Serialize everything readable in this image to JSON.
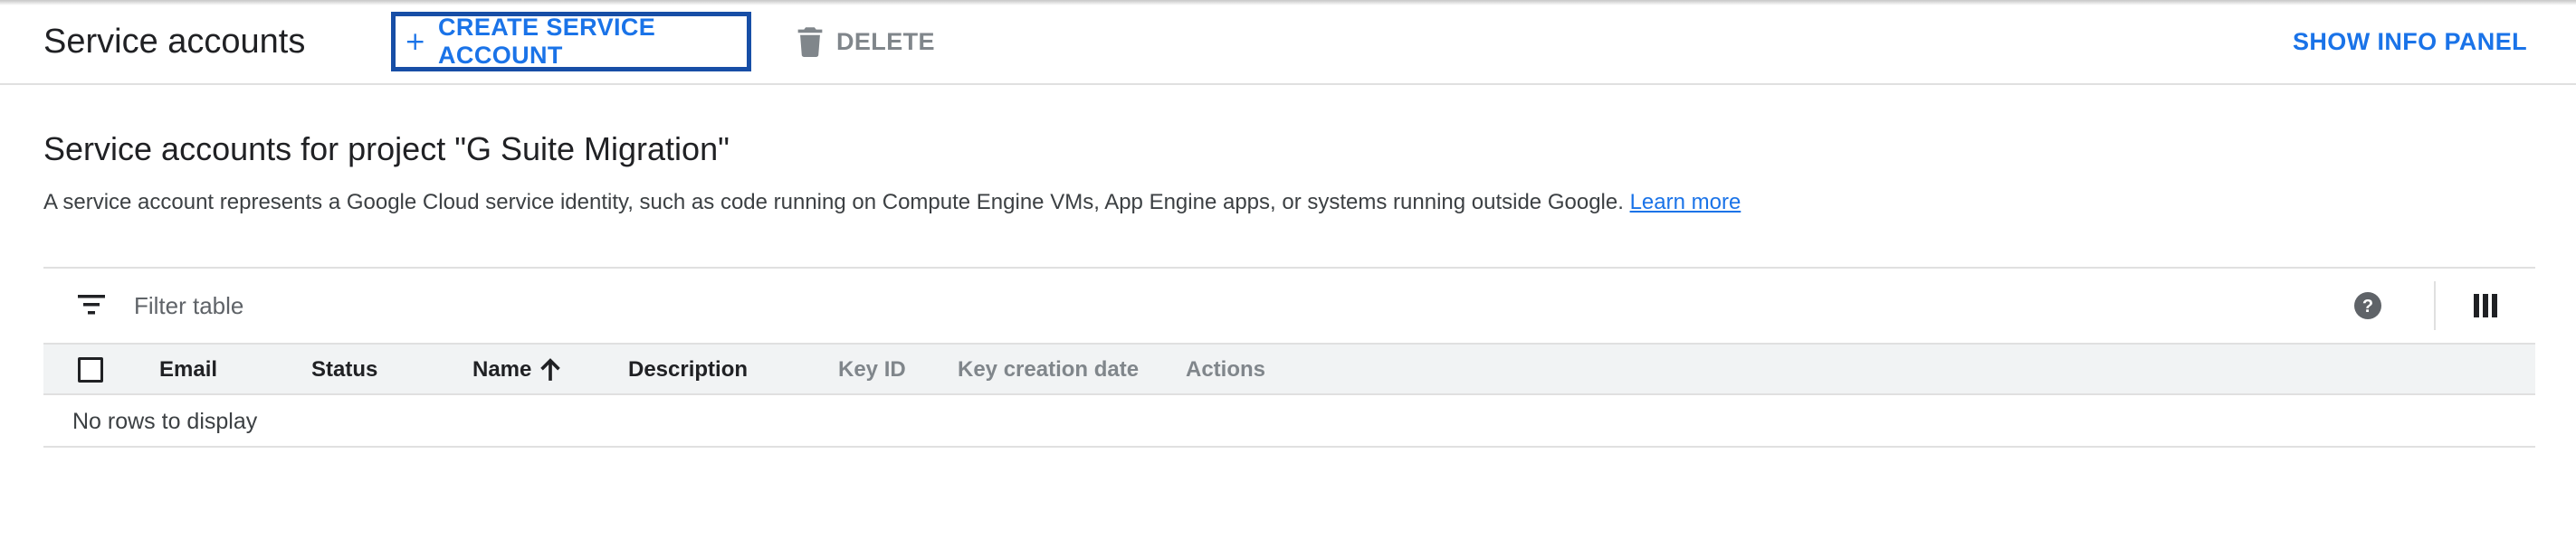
{
  "toolbar": {
    "title": "Service accounts",
    "create_label": "CREATE SERVICE ACCOUNT",
    "delete_label": "DELETE",
    "info_panel_label": "SHOW INFO PANEL"
  },
  "main": {
    "heading": "Service accounts for project \"G Suite Migration\"",
    "description": "A service account represents a Google Cloud service identity, such as code running on Compute Engine VMs, App Engine apps, or systems running outside Google.",
    "learn_more": "Learn more"
  },
  "table": {
    "filter_placeholder": "Filter table",
    "columns": [
      "Email",
      "Status",
      "Name",
      "Description",
      "Key ID",
      "Key creation date",
      "Actions"
    ],
    "sorted_column": "Name",
    "sort_direction": "ascending",
    "empty_message": "No rows to display"
  },
  "icons": {
    "create": "plus-icon",
    "delete": "trash-icon",
    "filter": "filter-list-icon",
    "help": "help-circle-icon",
    "columns": "column-display-icon",
    "sort": "arrow-up-icon"
  },
  "colors": {
    "accent": "#1a73e8",
    "focus_border": "#174ea6",
    "disabled_text": "#80868b",
    "header_bg": "#f1f3f4"
  }
}
